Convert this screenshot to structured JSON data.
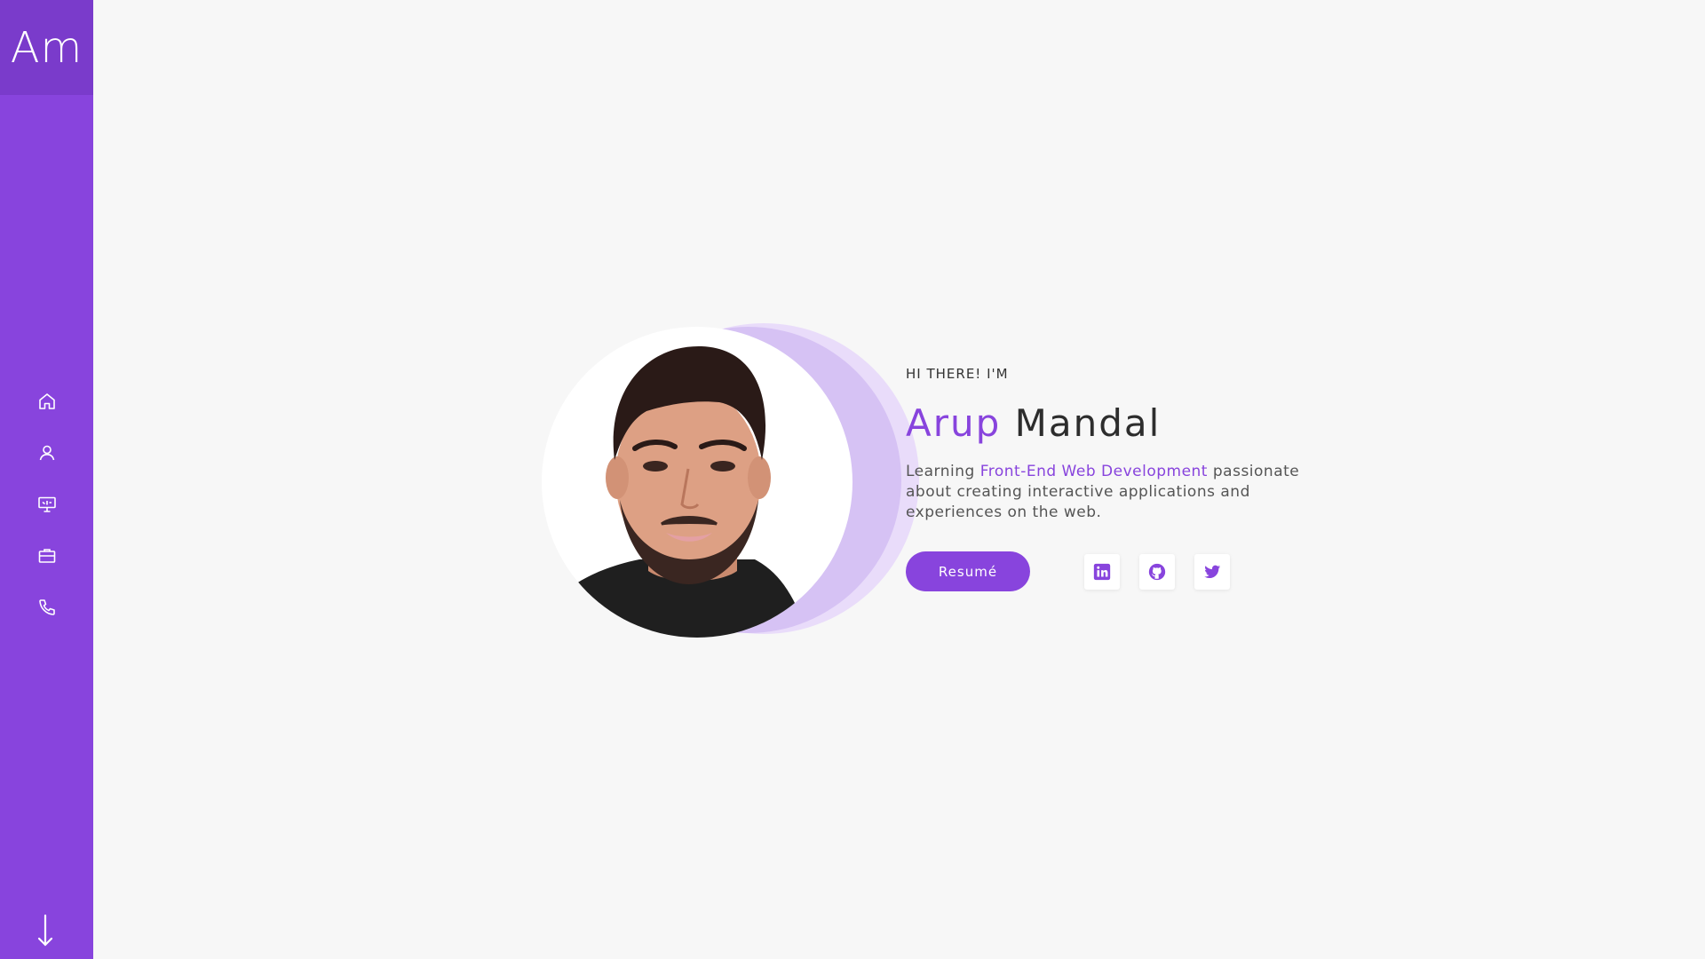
{
  "sidebar": {
    "logo": "Am",
    "nav_icons": [
      "home-icon",
      "user-icon",
      "presentation-icon",
      "briefcase-icon",
      "phone-icon"
    ],
    "scroll_icon": "arrow-down-icon"
  },
  "hero": {
    "greeting": "HI THERE! I'M",
    "first_name": "Arup",
    "last_name": "Mandal",
    "desc_before": "Learning ",
    "desc_highlight": "Front-End Web Development",
    "desc_after": " passionate about creating interactive applications and experiences on the web.",
    "resume_label": "Resumé",
    "socials": [
      "linkedin-icon",
      "github-icon",
      "twitter-icon"
    ]
  },
  "colors": {
    "accent": "#8844dd",
    "logo_bg": "#7a3bcb",
    "background": "#f7f7f7"
  }
}
